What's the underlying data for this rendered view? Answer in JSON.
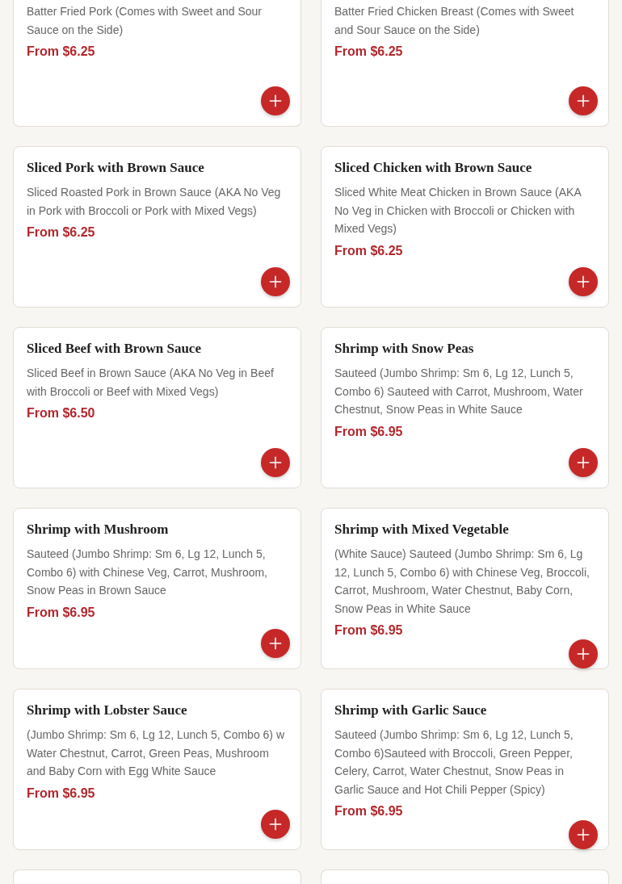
{
  "menu_items": [
    {
      "kind": "cut_top",
      "description": "Batter Fried Pork (Comes with Sweet and Sour Sauce on the Side)",
      "price": "From $6.25"
    },
    {
      "kind": "cut_top",
      "description": "Batter Fried Chicken Breast (Comes with Sweet and Sour Sauce on the Side)",
      "price": "From $6.25"
    },
    {
      "kind": "full",
      "title": "Sliced Pork with Brown Sauce",
      "description": "Sliced Roasted Pork in Brown Sauce (AKA No Veg in Pork with Broccoli or Pork with Mixed Vegs)",
      "price": "From $6.25"
    },
    {
      "kind": "full",
      "title": "Sliced Chicken with Brown Sauce",
      "description": "Sliced White Meat Chicken in Brown Sauce (AKA No Veg in Chicken with Broccoli or Chicken with Mixed Vegs)",
      "price": "From $6.25"
    },
    {
      "kind": "full",
      "title": "Sliced Beef with Brown Sauce",
      "description": "Sliced Beef in Brown Sauce (AKA No Veg in Beef with Broccoli or Beef with Mixed Vegs)",
      "price": "From $6.50"
    },
    {
      "kind": "full",
      "title": "Shrimp with Snow Peas",
      "description": "Sauteed (Jumbo Shrimp: Sm 6, Lg 12, Lunch 5, Combo 6) Sauteed with Carrot, Mushroom, Water Chestnut, Snow Peas in White Sauce",
      "price": "From $6.95"
    },
    {
      "kind": "full",
      "title": "Shrimp with Mushroom",
      "description": "Sauteed (Jumbo Shrimp: Sm 6, Lg 12, Lunch 5, Combo 6) with Chinese Veg, Carrot, Mushroom, Snow Peas in Brown Sauce",
      "price": "From $6.95"
    },
    {
      "kind": "full",
      "title": "Shrimp with Mixed Vegetable",
      "description": "(White Sauce) Sauteed (Jumbo Shrimp: Sm 6, Lg 12, Lunch 5, Combo 6) with Chinese Veg, Broccoli, Carrot, Mushroom, Water Chestnut, Baby Corn, Snow Peas in White Sauce",
      "price": "From $6.95"
    },
    {
      "kind": "full",
      "title": "Shrimp with Lobster Sauce",
      "description": "(Jumbo Shrimp: Sm 6, Lg 12, Lunch 5, Combo 6) w Water Chestnut, Carrot, Green Peas, Mushroom and Baby Corn with Egg White Sauce",
      "price": "From $6.95"
    },
    {
      "kind": "full",
      "title": "Shrimp with Garlic Sauce",
      "description": "Sauteed (Jumbo Shrimp: Sm 6, Lg 12, Lunch 5, Combo 6)Sauteed with Broccoli, Green Pepper, Celery, Carrot, Water Chestnut, Snow Peas in Garlic Sauce and Hot Chili Pepper (Spicy)",
      "price": "From $6.95"
    },
    {
      "kind": "cut_bottom"
    },
    {
      "kind": "cut_bottom"
    }
  ]
}
